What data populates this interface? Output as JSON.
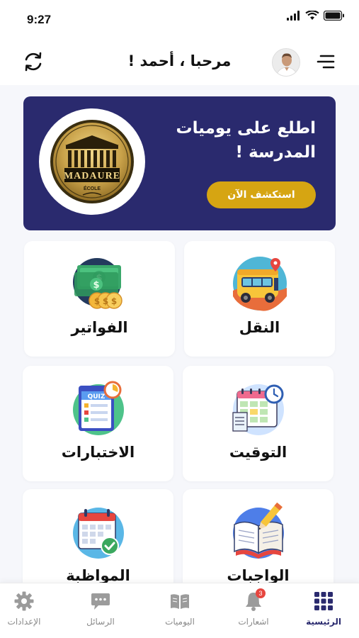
{
  "status_bar": {
    "time": "9:27"
  },
  "header": {
    "greeting": "مرحبا ، أحمد !"
  },
  "banner": {
    "title_line1": "اطلع على يوميات",
    "title_line2": "المدرسة !",
    "button_label": "استكشف الآن",
    "logo_text": "MADAURE",
    "logo_subtext": "ÉCOLE"
  },
  "cards": {
    "transport": "النقل",
    "invoices": "الفواتير",
    "schedule": "التوقيت",
    "tests": "الاختبارات",
    "homework": "الواجبات",
    "attendance": "المواظبة",
    "quiz_text": "QUIZ"
  },
  "bottom_nav": {
    "home": "الرئيسية",
    "notifications": "اشعارات",
    "notifications_badge": "3",
    "diaries": "اليوميات",
    "messages": "الرسائل",
    "settings": "الإعدادات"
  },
  "colors": {
    "primary": "#2a2a6e",
    "accent": "#d6a512",
    "badge": "#e6463f"
  }
}
